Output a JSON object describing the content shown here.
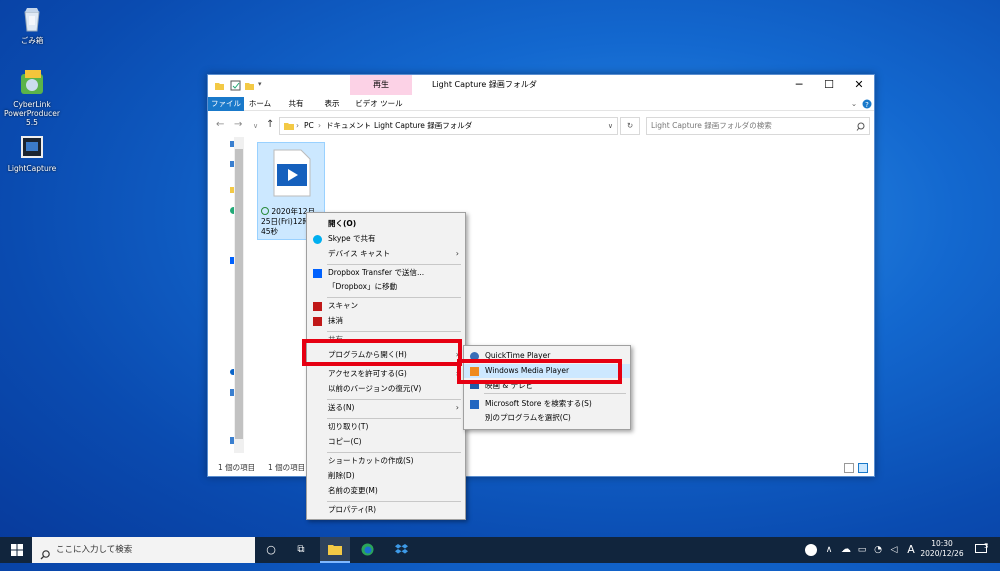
{
  "desktop": {
    "icons": [
      {
        "label": "ごみ箱"
      },
      {
        "label": "CyberLink PowerProducer 5.5"
      },
      {
        "label": "LightCapture"
      }
    ]
  },
  "window": {
    "context_tab": "再生",
    "title": "Light Capture 録画フォルダ",
    "ribbon_tabs": [
      "ファイル",
      "ホーム",
      "共有",
      "表示",
      "ビデオ ツール"
    ],
    "breadcrumb": [
      "PC",
      "ドキュメント",
      "Light Capture 録画フォルダ"
    ],
    "search_placeholder": "Light Capture 録画フォルダの検索",
    "file_name": "2020年12月25日(Fri)12時分45秒",
    "status_left": "1 個の項目",
    "status_selected": "1 個の項目を"
  },
  "context_menu": {
    "items": [
      "開く(O)",
      "Skype で共有",
      "デバイス キャスト",
      "Dropbox Transfer で送信...",
      "「Dropbox」に移動",
      "スキャン",
      "抹消",
      "共有",
      "プログラムから開く(H)",
      "アクセスを許可する(G)",
      "以前のバージョンの復元(V)",
      "送る(N)",
      "切り取り(T)",
      "コピー(C)",
      "ショートカットの作成(S)",
      "削除(D)",
      "名前の変更(M)",
      "プロパティ(R)"
    ]
  },
  "submenu": {
    "items": [
      "QuickTime Player",
      "Windows Media Player",
      "映画 & テレビ",
      "Microsoft Store を検索する(S)",
      "別のプログラムを選択(C)"
    ]
  },
  "taskbar": {
    "search_placeholder": "ここに入力して検索",
    "ime": "A",
    "time": "10:30",
    "date": "2020/12/26",
    "notifications": "3"
  },
  "colors": {
    "highlight": "#e60012",
    "accent": "#0078d7",
    "context_tab": "#fcd2e6"
  }
}
